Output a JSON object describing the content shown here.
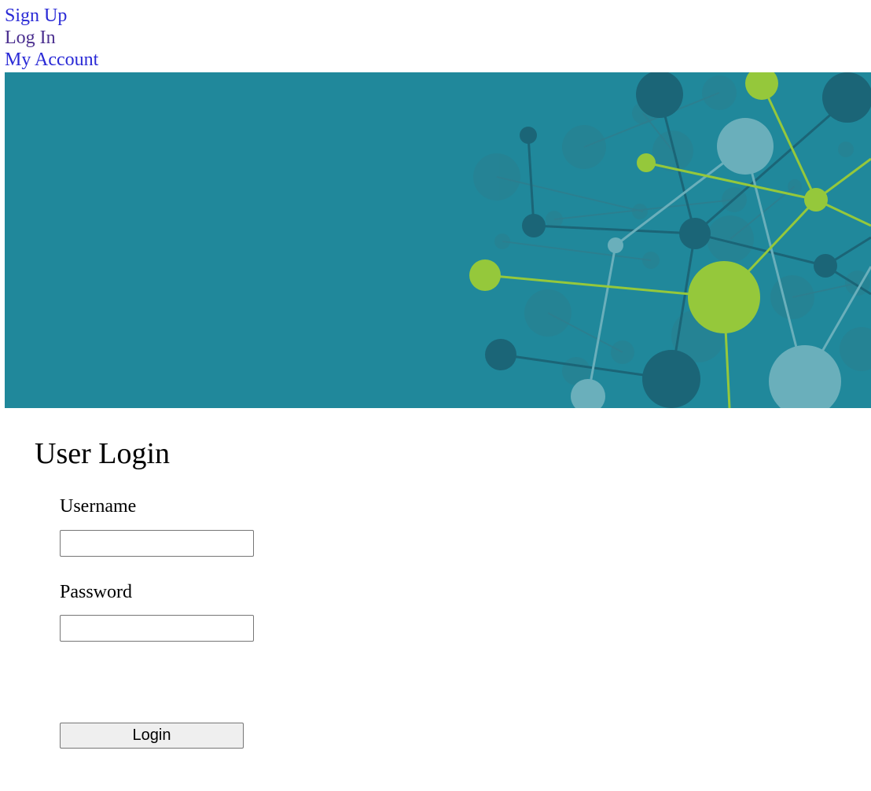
{
  "nav": {
    "links": [
      {
        "label": "Sign Up",
        "color": "#2a2ad6"
      },
      {
        "label": "Log In",
        "color": "#4b2f8f"
      },
      {
        "label": "My Account",
        "color": "#2a2ad6"
      }
    ]
  },
  "banner": {
    "image": "molecular-network-graphic",
    "background_color": "#20889b",
    "node_colors": [
      "#1b6577",
      "#6aafbb",
      "#95c83b"
    ]
  },
  "login_form": {
    "title": "User Login",
    "username_label": "Username",
    "username_value": "",
    "password_label": "Password",
    "password_value": "",
    "submit_label": "Login"
  }
}
